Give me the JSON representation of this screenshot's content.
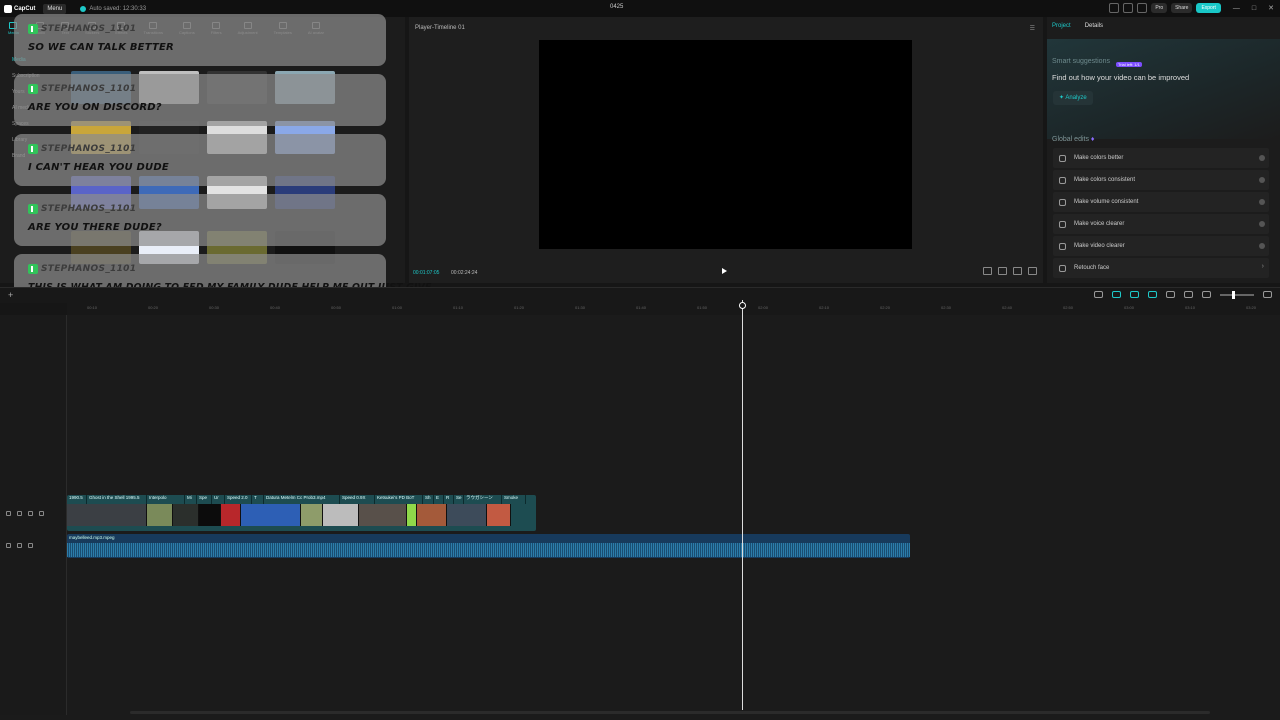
{
  "titlebar": {
    "logo": "CapCut",
    "menu": "Menu",
    "autosave": "Auto saved: 12:30:33",
    "doc_title": "0425",
    "pro": "Pro",
    "share": "Share",
    "export": "Export"
  },
  "media_tools": [
    "Media",
    "Audio",
    "Text",
    "Stickers",
    "Effects",
    "Transitions",
    "Captions",
    "Filters",
    "Adjustment",
    "Templates",
    "AI avatar"
  ],
  "side_nav": [
    "Media",
    "Subscription",
    "Yours",
    "AI media",
    "Spaces",
    "Library",
    "Brand"
  ],
  "chat_messages": [
    {
      "user": "STEPHANOS_1101",
      "text": "SO WE CAN TALK BETTER"
    },
    {
      "user": "STEPHANOS_1101",
      "text": "ARE YOU ON DISCORD?"
    },
    {
      "user": "STEPHANOS_1101",
      "text": "I CAN'T HEAR YOU DUDE"
    },
    {
      "user": "STEPHANOS_1101",
      "text": "ARE YOU THERE DUDE?"
    },
    {
      "user": "STEPHANOS_1101",
      "text": "THIS IS WHAT AM DOING TO FED MY FAMILY DUDE HELP ME OUT JUST GIVE"
    }
  ],
  "player": {
    "title": "Player-Timeline 01",
    "current_time": "00:01:07:05",
    "total_time": "00:02:24:24"
  },
  "right_panel": {
    "tab_project": "Project",
    "tab_details": "Details",
    "smart_title": "Smart suggestions",
    "smart_badge": "Trial left: 1/1",
    "smart_sub": "Find out how your video can be improved",
    "analyze": "Analyze",
    "global_title": "Global edits",
    "edits": [
      "Make colors better",
      "Make colors consistent",
      "Make volume consistent",
      "Make voice clearer",
      "Make video clearer",
      "Retouch face"
    ]
  },
  "ruler_ticks": [
    "00:10",
    "00:20",
    "00:30",
    "00:40",
    "00:50",
    "01:00",
    "01:10",
    "01:20",
    "01:30",
    "01:40",
    "01:50",
    "02:00",
    "02:10",
    "02:20",
    "02:30",
    "02:40",
    "02:50",
    "03:00",
    "03:10",
    "03:20"
  ],
  "video_clips": [
    "1990.5",
    "Ghost in the Shell 1995.5",
    "Interpolo",
    "Mi",
    "Spe",
    "Ur",
    "Speed 2.0",
    "T",
    "Datura Metelm Cc Prob3.mp4",
    "Speed 0.9X",
    "Ketsukei's PD BoT",
    "Sh",
    "E",
    "R",
    "Se",
    "ラウガシーン",
    "Smoke"
  ],
  "audio_clip": "maybelleed.mp3.mpeg"
}
